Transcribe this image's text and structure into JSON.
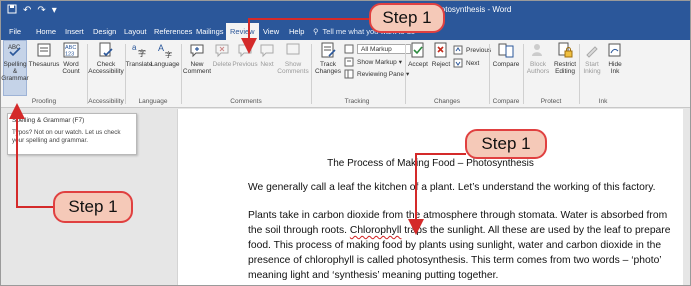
{
  "titlebar": {
    "quick_access": [
      "Save",
      "Undo",
      "Redo",
      "Customize"
    ],
    "document_title": "Photosynthesis - Word"
  },
  "tabs": [
    "File",
    "Home",
    "Insert",
    "Design",
    "Layout",
    "References",
    "Mailings",
    "Review",
    "View",
    "Help"
  ],
  "active_tab": "Review",
  "tell_me": "Tell me what you want to do",
  "ribbon": {
    "proofing": {
      "spelling": "Spelling & Grammar",
      "thesaurus": "Thesaurus",
      "word_count": "Word Count",
      "label": "Proofing"
    },
    "accessibility": {
      "check": "Check Accessibility",
      "label": "Accessibility"
    },
    "language": {
      "translate": "Translate",
      "language": "Language",
      "label": "Language"
    },
    "comments": {
      "new": "New Comment",
      "delete": "Delete",
      "previous": "Previous",
      "next": "Next",
      "show": "Show Comments",
      "label": "Comments"
    },
    "tracking": {
      "track_changes": "Track Changes",
      "all_markup": "All Markup",
      "show_markup": "Show Markup",
      "reviewing_pane": "Reviewing Pane",
      "label": "Tracking"
    },
    "changes": {
      "accept": "Accept",
      "reject": "Reject",
      "previous": "Previous",
      "next": "Next",
      "label": "Changes"
    },
    "compare": {
      "compare": "Compare",
      "label": "Compare"
    },
    "protect": {
      "block": "Block Authors",
      "restrict": "Restrict Editing",
      "label": "Protect"
    },
    "ink": {
      "start": "Start Inking",
      "hide": "Hide Ink",
      "label": "Ink"
    }
  },
  "tooltip": {
    "title": "Spelling & Grammar (F7)",
    "description": "Typos? Not on our watch. Let us check your spelling and grammar."
  },
  "document": {
    "heading": "The Process of Making Food – Photosynthesis",
    "para1": "We generally call a leaf the kitchen of a plant. Let’s understand the working of this factory.",
    "para2_before": "Plants take in carbon dioxide from the atmosphere through stomata. Water is absorbed from the soil through roots. ",
    "para2_word": "Chlorophyll",
    "para2_after": " traps the sunlight. All these are used by the leaf to prepare food. This process of making food by plants using sunlight, water and carbon dioxide in the presence of chlorophyll is called photosynthesis. This term comes from two words – ‘photo’ meaning light and ‘synthesis’ meaning putting together."
  },
  "callouts": {
    "top": "Step 1",
    "right": "Step 1",
    "left": "Step 1"
  },
  "colors": {
    "word_blue": "#2b579a",
    "callout_fill": "#f5c9b8",
    "callout_border": "#e04040"
  }
}
